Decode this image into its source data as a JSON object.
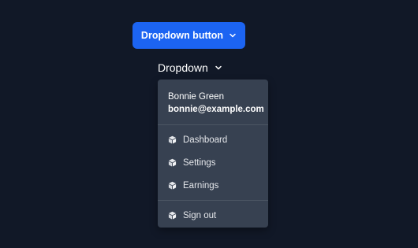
{
  "primary_button": {
    "label": "Dropdown button",
    "icon": "chevron-down-icon",
    "color": "#1c64f2"
  },
  "text_toggle": {
    "label": "Dropdown",
    "icon": "chevron-down-icon"
  },
  "menu": {
    "user": {
      "name": "Bonnie Green",
      "email": "bonnie@example.com"
    },
    "items": [
      {
        "label": "Dashboard",
        "icon": "cube-icon"
      },
      {
        "label": "Settings",
        "icon": "cube-icon"
      },
      {
        "label": "Earnings",
        "icon": "cube-icon"
      }
    ],
    "footer_item": {
      "label": "Sign out",
      "icon": "cube-icon"
    }
  },
  "colors": {
    "background": "#111827",
    "menu_background": "#374151",
    "divider": "#4b5563"
  }
}
